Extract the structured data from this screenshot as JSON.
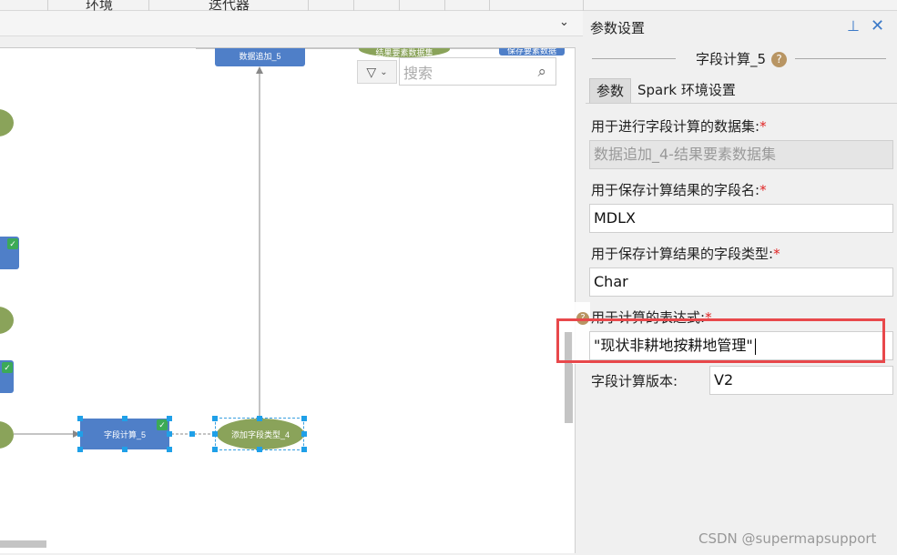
{
  "top_tabs": [
    "环境",
    "迭代器"
  ],
  "canvas": {
    "nodes": {
      "data_append": "数据追加_5",
      "result_dataset": "结果要素数据集",
      "save_dataset": "保存要素数据",
      "field_calc": "字段计算_5",
      "add_field_type": "添加字段类型_4"
    },
    "search_placeholder": "搜索"
  },
  "panel": {
    "title": "参数设置",
    "group_title": "字段计算_5",
    "tabs": [
      "参数",
      "Spark 环境设置"
    ],
    "fields": {
      "dataset_label": "用于进行字段计算的数据集:",
      "dataset_value": "数据追加_4-结果要素数据集",
      "field_name_label": "用于保存计算结果的字段名:",
      "field_name_value": "MDLX",
      "field_type_label": "用于保存计算结果的字段类型:",
      "field_type_value": "Char",
      "expression_label": "用于计算的表达式:",
      "expression_value": "\"现状非耕地按耕地管理\"",
      "version_label": "字段计算版本:",
      "version_value": "V2"
    }
  },
  "watermark": "CSDN @supermapsupport"
}
